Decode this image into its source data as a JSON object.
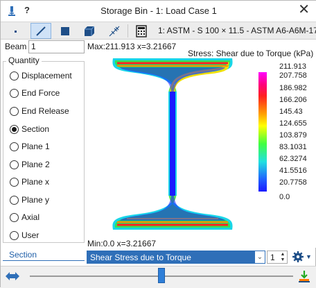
{
  "window": {
    "title": "Storage Bin - 1: Load Case 1",
    "help": "?",
    "close_icon": "close-icon"
  },
  "toolbar": {
    "tools": [
      "point-view-icon",
      "line-view-icon",
      "solid-view-icon",
      "3d-view-icon",
      "diagram-view-icon",
      "table-view-icon"
    ],
    "load_case_label": "1: ASTM - S 100 × 11.5 - ASTM A6-A6M-17"
  },
  "beam": {
    "label": "Beam",
    "value": "1"
  },
  "quantity": {
    "title": "Quantity",
    "options": [
      {
        "label": "Displacement",
        "checked": false
      },
      {
        "label": "End Force",
        "checked": false
      },
      {
        "label": "End Release",
        "checked": false
      },
      {
        "label": "Section",
        "checked": true
      },
      {
        "label": "Plane 1",
        "checked": false
      },
      {
        "label": "Plane 2",
        "checked": false
      },
      {
        "label": "Plane x",
        "checked": false
      },
      {
        "label": "Plane y",
        "checked": false
      },
      {
        "label": "Axial",
        "checked": false
      },
      {
        "label": "User",
        "checked": false
      }
    ]
  },
  "section_tab": "Section",
  "plot": {
    "max_label": "Max:211.913 x=3.21667",
    "min_label": "Min:0.0 x=3.21667",
    "stress_title": "Stress: Shear due to Torque (kPa)",
    "legend_ticks": [
      "211.913",
      "207.758",
      "186.982",
      "166.206",
      "145.43",
      "124.655",
      "103.879",
      "83.1031",
      "62.3274",
      "41.5516",
      "20.7758",
      "0.0"
    ],
    "colors": {
      "high": "#ff00ff",
      "mid": "#22dd22",
      "low": "#1a1aff",
      "zero": "#ffffff"
    }
  },
  "result": {
    "selected": "Shear Stress due to Torque",
    "spin_value": "1"
  },
  "slider": {
    "fraction": 0.5
  },
  "colors": {
    "accent": "#2f6fb8",
    "toolbar_bg": "#ececec",
    "active_tool": "#cfe2f7"
  }
}
